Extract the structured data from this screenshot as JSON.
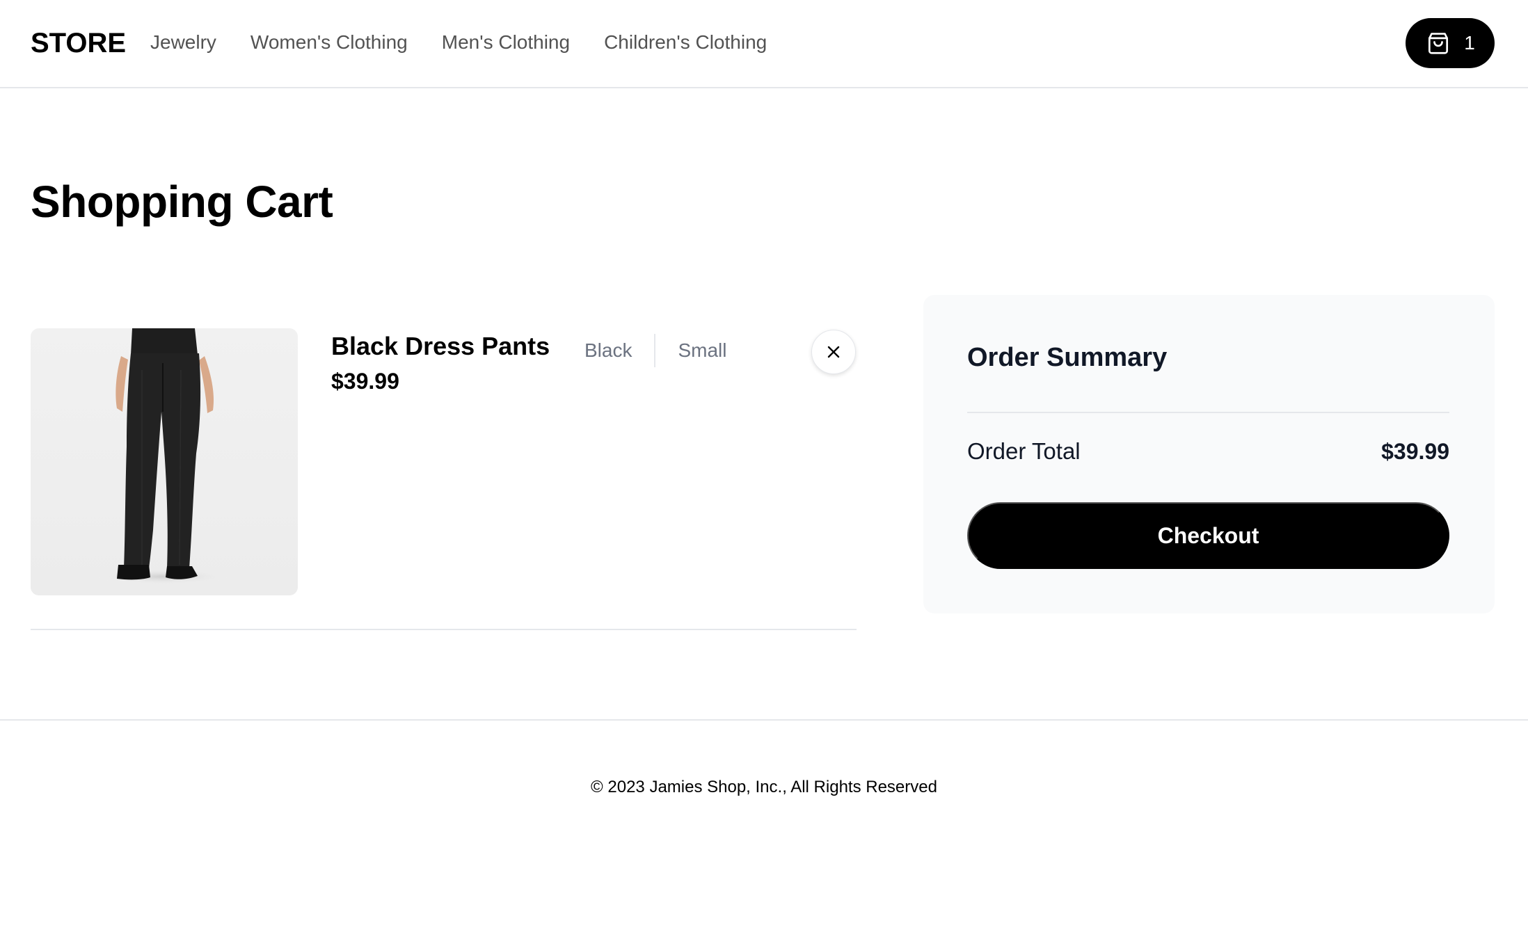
{
  "header": {
    "logo": "STORE",
    "nav": [
      {
        "label": "Jewelry"
      },
      {
        "label": "Women's Clothing"
      },
      {
        "label": "Men's Clothing"
      },
      {
        "label": "Children's Clothing"
      }
    ],
    "cart": {
      "icon": "shopping-bag-icon",
      "count": "1"
    }
  },
  "page": {
    "title": "Shopping Cart"
  },
  "cart_items": [
    {
      "name": "Black Dress Pants",
      "price": "$39.99",
      "color": "Black",
      "size": "Small",
      "remove_icon": "close-icon"
    }
  ],
  "summary": {
    "title": "Order Summary",
    "total_label": "Order Total",
    "total_value": "$39.99",
    "checkout_label": "Checkout"
  },
  "footer": {
    "copyright": "© 2023 Jamies Shop, Inc., All Rights Reserved"
  },
  "colors": {
    "accent": "#000000",
    "muted_text": "#6b7280",
    "nav_text": "#525252",
    "border": "#e5e7eb",
    "summary_bg": "#f9fafb"
  }
}
